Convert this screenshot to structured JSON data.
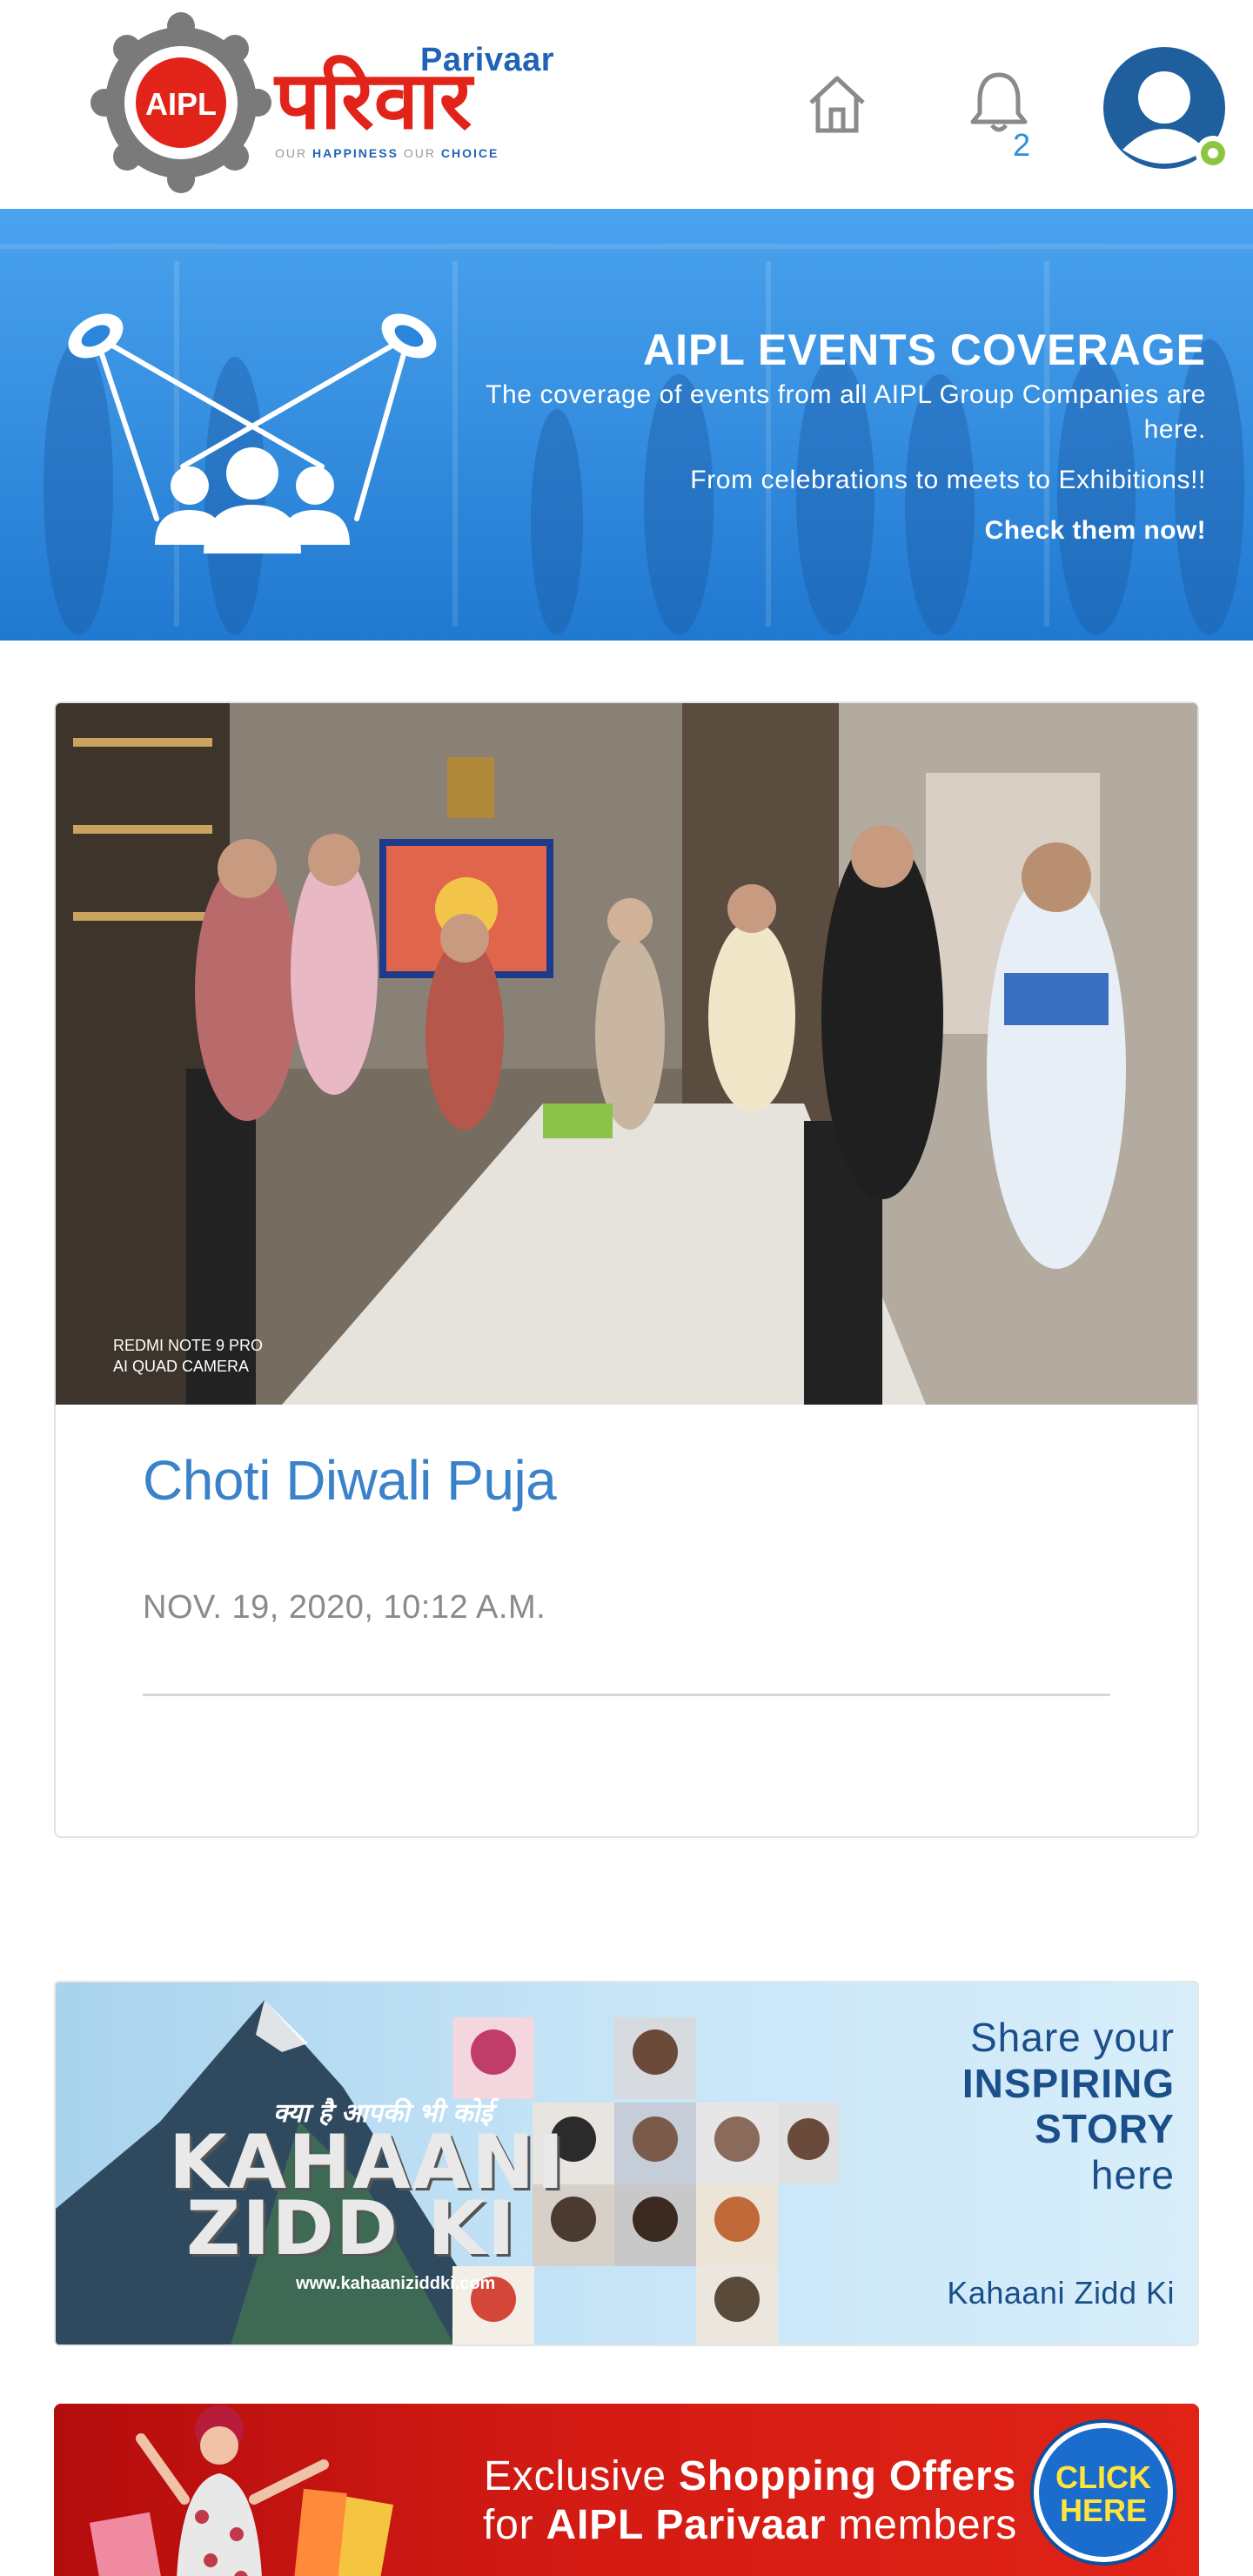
{
  "header": {
    "logo": {
      "parivaar_label": "Parivaar",
      "hindi_wordmark": "परिवार",
      "tagline_our1": "OUR",
      "tagline_happiness": "HAPPINESS",
      "tagline_our2": "OUR",
      "tagline_choice": "CHOICE",
      "badge_text": "AIPL"
    },
    "notification_count": "2",
    "icons": {
      "home": "home-icon",
      "bell": "bell-icon",
      "avatar": "user-avatar-icon"
    },
    "colors": {
      "brand_red": "#e2231a",
      "brand_blue": "#1f63b6",
      "online_dot": "#8cc63f"
    }
  },
  "banner": {
    "title": "AIPL EVENTS COVERAGE",
    "line1": "The coverage of events from all AIPL Group Companies are here.",
    "line2": "From celebrations to meets to Exhibitions!!",
    "cta": "Check them now!",
    "color": "#2a86dd"
  },
  "event_card": {
    "photo_watermark_line1": "REDMI NOTE 9 PRO",
    "photo_watermark_line2": "AI QUAD CAMERA",
    "title": "Choti Diwali Puja",
    "date": "NOV. 19, 2020, 10:12 A.M."
  },
  "story_banner": {
    "kz_hindi": "क्या है आपकी भी कोई",
    "kz_line1": "KAHAANI",
    "kz_line2": "ZIDD KI",
    "kz_url": "www.kahaaniziddki.com",
    "right_line1": "Share your",
    "right_line2": "INSPIRING",
    "right_line3": "STORY",
    "right_line4": "here",
    "footer": "Kahaani Zidd Ki"
  },
  "shop_banner": {
    "exclusive": "Exclusive",
    "shopping_offers": "Shopping Offers",
    "for": "for",
    "aipl_parivaar": "AIPL Parivaar",
    "members": "members",
    "click_line1": "CLICK",
    "click_line2": "HERE"
  }
}
